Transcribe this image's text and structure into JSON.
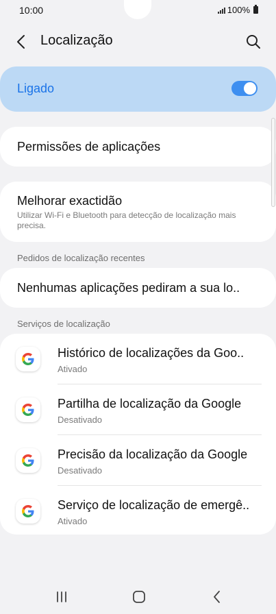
{
  "status": {
    "time": "10:00",
    "battery": "100%"
  },
  "appbar": {
    "title": "Localização",
    "back_icon": "chevron-left-icon",
    "search_icon": "search-icon"
  },
  "master": {
    "label": "Ligado",
    "on": true,
    "accent": "#1a73e8",
    "bg": "#bcd9f5"
  },
  "app_permissions": {
    "label": "Permissões de aplicações"
  },
  "accuracy": {
    "title": "Melhorar exactidão",
    "subtitle": "Utilizar Wi-Fi e Bluetooth para detecção de localização mais precisa."
  },
  "recent": {
    "header": "Pedidos de localização recentes",
    "text": "Nenhumas aplicações pediram a sua lo.."
  },
  "services": {
    "header": "Serviços de localização",
    "items": [
      {
        "title": "Histórico de localizações da Goo..",
        "status": "Ativado",
        "icon": "google-icon"
      },
      {
        "title": "Partilha de localização da Google",
        "status": "Desativado",
        "icon": "google-icon"
      },
      {
        "title": "Precisão da localização da Google",
        "status": "Desativado",
        "icon": "google-icon"
      },
      {
        "title": "Serviço de localização de emergê..",
        "status": "Ativado",
        "icon": "google-icon"
      }
    ]
  },
  "navbar": {
    "recents_icon": "recents-icon",
    "home_icon": "home-icon",
    "back_icon": "back-nav-icon"
  }
}
